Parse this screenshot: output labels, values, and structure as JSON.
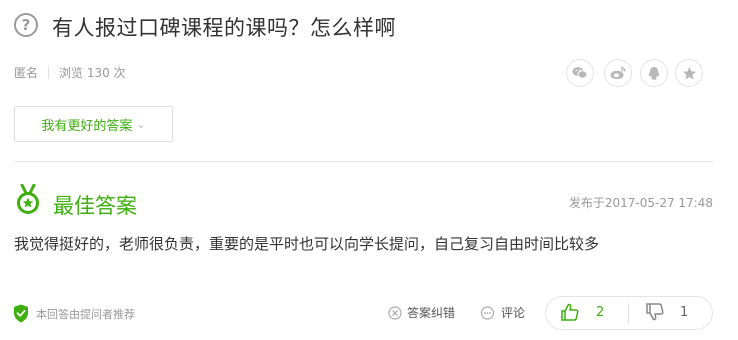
{
  "question": {
    "title": "有人报过口碑课程的课吗？怎么样啊",
    "author": "匿名",
    "views": "浏览 130 次"
  },
  "share": {
    "icons": [
      "wechat-icon",
      "weibo-icon",
      "qq-icon",
      "favorite-icon"
    ]
  },
  "better_answer_button": "我有更好的答案",
  "best_answer": {
    "heading": "最佳答案",
    "published": "发布于2017-05-27 17:48",
    "text": "我觉得挺好的，老师很负责，重要的是平时也可以向学长提问，自己复习自由时间比较多",
    "recommend_note": "本回答由提问者推荐",
    "correct_label": "答案纠错",
    "comment_label": "评论",
    "upvotes": "2",
    "downvotes": "1"
  },
  "colors": {
    "accent": "#3eaf0e",
    "muted": "#999999",
    "border": "#e5e5e5"
  }
}
